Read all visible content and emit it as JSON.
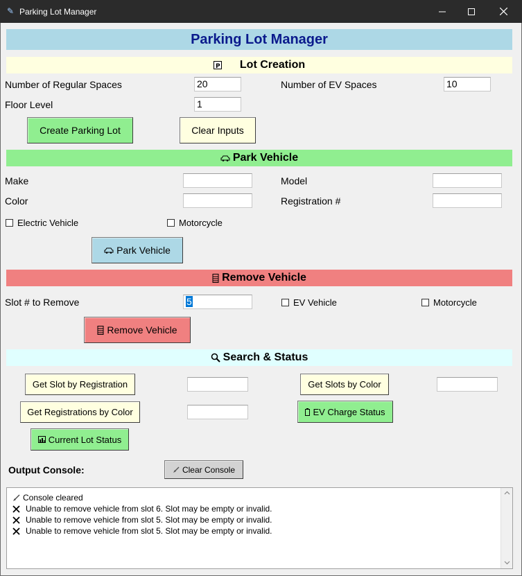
{
  "window": {
    "title": "Parking Lot Manager",
    "icon": "feather-icon"
  },
  "app_title": "Parking Lot Manager",
  "lot_creation": {
    "header": "Lot Creation",
    "header_icon": "parking-sign-icon",
    "regular_label": "Number of Regular Spaces",
    "regular_value": "20",
    "ev_label": "Number of EV Spaces",
    "ev_value": "10",
    "floor_label": "Floor Level",
    "floor_value": "1",
    "create_btn": "Create Parking Lot",
    "clear_btn": "Clear Inputs"
  },
  "park_vehicle": {
    "header": "Park Vehicle",
    "header_icon": "car-icon",
    "make_label": "Make",
    "make_value": "",
    "model_label": "Model",
    "model_value": "",
    "color_label": "Color",
    "color_value": "",
    "reg_label": "Registration #",
    "reg_value": "",
    "electric_label": "Electric Vehicle",
    "motorcycle_label": "Motorcycle",
    "park_btn": "Park Vehicle"
  },
  "remove_vehicle": {
    "header": "Remove Vehicle",
    "header_icon": "barrier-icon",
    "slot_label": "Slot # to Remove",
    "slot_value": "5",
    "ev_label": "EV Vehicle",
    "motorcycle_label": "Motorcycle",
    "remove_btn": "Remove Vehicle"
  },
  "search_status": {
    "header": "Search & Status",
    "header_icon": "magnifier-icon",
    "slot_by_reg_btn": "Get Slot by Registration",
    "slots_by_color_btn": "Get Slots by Color",
    "regs_by_color_btn": "Get Registrations by Color",
    "ev_charge_btn": "EV Charge Status",
    "lot_status_btn": "Current Lot Status"
  },
  "console": {
    "label": "Output Console:",
    "clear_btn": "Clear Console",
    "lines": [
      {
        "icon": "broom-icon",
        "text": "Console cleared"
      },
      {
        "icon": "cross-icon",
        "text": "Unable to remove vehicle from slot 6. Slot may be empty or invalid."
      },
      {
        "icon": "cross-icon",
        "text": "Unable to remove vehicle from slot 5. Slot may be empty or invalid."
      },
      {
        "icon": "cross-icon",
        "text": "Unable to remove vehicle from slot 5. Slot may be empty or invalid."
      }
    ]
  },
  "colors": {
    "title_bg": "#add8e6",
    "lot_creation_bg": "#ffffe0",
    "park_bg": "#90ee90",
    "remove_bg": "#f08080",
    "search_bg": "#e0ffff",
    "title_text": "#0a1a8c"
  }
}
